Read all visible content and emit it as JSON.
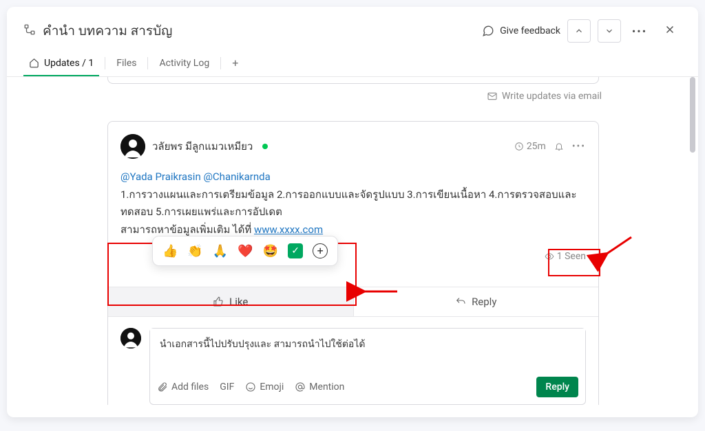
{
  "header": {
    "title": "คำนำ บทความ สารบัญ",
    "feedback": "Give feedback"
  },
  "tabs": {
    "updates": "Updates / 1",
    "files": "Files",
    "activity": "Activity Log"
  },
  "emailLine": "Write updates via email",
  "post": {
    "author": "วลัยพร มีลูกแมวเหมียว",
    "time": "25m",
    "mentions": "@Yada Praikrasin @Chanikarnda",
    "body": "1.การวางแผนและการเตรียมข้อมูล 2.การออกแบบและจัดรูปแบบ 3.การเขียนเนื้อหา 4.การตรวจสอบและทดสอบ 5.การเผยแพร่และการอัปเดต",
    "more_prefix": "สามารถหาข้อมูลเพิ่มเติม ได้ที่ ",
    "link": "www.xxxx.com",
    "seen": "1 Seen",
    "like": "Like",
    "reply": "Reply"
  },
  "compose": {
    "text": "นำเอกสารนี้ไปปรับปรุงและ สามารถนำไปใช้ต่อได้",
    "addfiles": "Add files",
    "gif": "GIF",
    "emoji": "Emoji",
    "mention": "Mention",
    "replyBtn": "Reply"
  }
}
